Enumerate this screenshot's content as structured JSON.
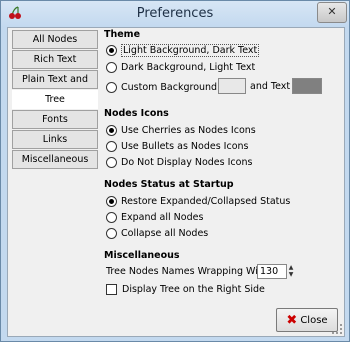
{
  "window": {
    "title": "Preferences"
  },
  "tabs": [
    {
      "label": "All Nodes"
    },
    {
      "label": "Rich Text"
    },
    {
      "label": "Plain Text and Code"
    },
    {
      "label": "Tree"
    },
    {
      "label": "Fonts"
    },
    {
      "label": "Links"
    },
    {
      "label": "Miscellaneous"
    }
  ],
  "active_tab": "Tree",
  "theme": {
    "heading": "Theme",
    "options": [
      {
        "label": "Light Background, Dark Text",
        "selected": true
      },
      {
        "label": "Dark Background, Light Text",
        "selected": false
      },
      {
        "label": "Custom Background",
        "selected": false
      }
    ],
    "and_text_label": "and Text",
    "custom_bg_color": "#e8e8e8",
    "custom_text_color": "#808080"
  },
  "nodes_icons": {
    "heading": "Nodes Icons",
    "options": [
      {
        "label": "Use Cherries as Nodes Icons",
        "selected": true
      },
      {
        "label": "Use Bullets as Nodes Icons",
        "selected": false
      },
      {
        "label": "Do Not Display Nodes Icons",
        "selected": false
      }
    ]
  },
  "startup": {
    "heading": "Nodes Status at Startup",
    "options": [
      {
        "label": "Restore Expanded/Collapsed Status",
        "selected": true
      },
      {
        "label": "Expand all Nodes",
        "selected": false
      },
      {
        "label": "Collapse all Nodes",
        "selected": false
      }
    ]
  },
  "misc": {
    "heading": "Miscellaneous",
    "wrap_label": "Tree Nodes Names Wrapping Width",
    "wrap_value": "130",
    "right_side_label": "Display Tree on the Right Side",
    "right_side_checked": false
  },
  "footer": {
    "close_label": "Close"
  },
  "colors": {
    "accent": "#c3d9ef",
    "close_red": "#cc0000"
  }
}
